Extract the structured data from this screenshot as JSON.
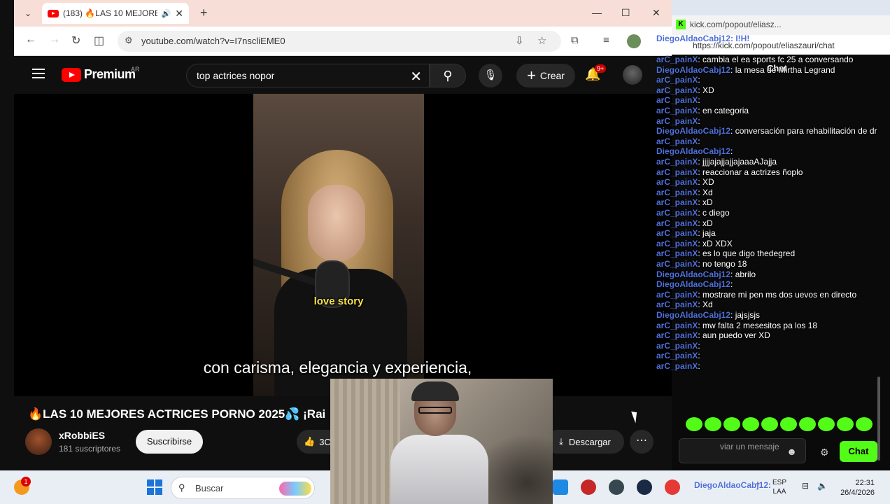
{
  "browser": {
    "tab_title": "(183) 🔥LAS 10 MEJORES A",
    "url": "youtube.com/watch?v=I7nscliEME0"
  },
  "youtube": {
    "logo_text": "Premium",
    "region": "AR",
    "search_value": "top actrices nopor",
    "create_label": "Crear",
    "notif_count": "9+",
    "subtitle": "con carisma, elegancia y experiencia,",
    "in_video_caption": "love story",
    "video_title": "🔥LAS 10 MEJORES ACTRICES PORNO 2025💦 ¡Rai",
    "channel_name": "xRobbiES",
    "channel_subs": "181 suscriptores",
    "subscribe_label": "Suscribirse",
    "like_count": "3C",
    "download_label": "Descargar"
  },
  "kick": {
    "window_title": "kick.com/popout/eliasz...",
    "url": "https://kick.com/popout/eliaszauri/chat",
    "chat_header": "Chat",
    "top_user_overlay": "DiegoAldaoCabj12: I!H!",
    "messages": [
      {
        "user": "arC_painX",
        "text": ": cambia el ea sports fc 25 a conversando"
      },
      {
        "user": "DiegoAldaoCabj12",
        "text": ": la mesa de Mirtha Legrand"
      },
      {
        "user": "arC_painX",
        "text": ":"
      },
      {
        "user": "arC_painX",
        "text": ": XD"
      },
      {
        "user": "arC_painX",
        "text": ":"
      },
      {
        "user": "arC_painX",
        "text": ": en categoria"
      },
      {
        "user": "arC_painX",
        "text": ":"
      },
      {
        "user": "DiegoAldaoCabj12",
        "text": ": conversación para rehabilitación de dr"
      },
      {
        "user": "arC_painX",
        "text": ":"
      },
      {
        "user": "DiegoAldaoCabj12",
        "text": ":"
      },
      {
        "user": "arC_painX",
        "text": ": jjjjajajjajjajaaaAJajja"
      },
      {
        "user": "arC_painX",
        "text": ": reaccionar a actrizes ñoplo"
      },
      {
        "user": "arC_painX",
        "text": ": XD"
      },
      {
        "user": "arC_painX",
        "text": ": Xd"
      },
      {
        "user": "arC_painX",
        "text": ": xD"
      },
      {
        "user": "arC_painX",
        "text": ": c diego"
      },
      {
        "user": "arC_painX",
        "text": ": xD"
      },
      {
        "user": "arC_painX",
        "text": ": jaja"
      },
      {
        "user": "arC_painX",
        "text": ": xD XDX"
      },
      {
        "user": "arC_painX",
        "text": ": es lo que digo thedegred"
      },
      {
        "user": "arC_painX",
        "text": ": no tengo 18"
      },
      {
        "user": "DiegoAldaoCabj12",
        "text": ": abrilo"
      },
      {
        "user": "DiegoAldaoCabj12",
        "text": ":"
      },
      {
        "user": "arC_painX",
        "text": ": mostrare mi pen ms dos uevos en directo"
      },
      {
        "user": "arC_painX",
        "text": ": Xd"
      },
      {
        "user": "DiegoAldaoCabj12",
        "text": ": jajsjsjs"
      },
      {
        "user": "arC_painX",
        "text": ": mw falta 2 mesesitos pa los 18"
      },
      {
        "user": "arC_painX",
        "text": ": aun puedo ver XD"
      },
      {
        "user": "arC_painX",
        "text": ":"
      },
      {
        "user": "arC_painX",
        "text": ":"
      },
      {
        "user": "arC_painX",
        "text": ":"
      }
    ],
    "input_placeholder": "viar un mensaje",
    "send_label": "Chat",
    "bottom_user_overlay": "DiegoAldaoCabj12:"
  },
  "taskbar": {
    "weather_badge": "1",
    "search_label": "Buscar",
    "lang_line1": "ESP",
    "lang_line2": "LAA",
    "time": "22:31",
    "date": "26/4/2026"
  },
  "colors": {
    "kick_green": "#53fc18",
    "yt_red": "#ff0000",
    "username_blue": "#4f6fd8"
  }
}
